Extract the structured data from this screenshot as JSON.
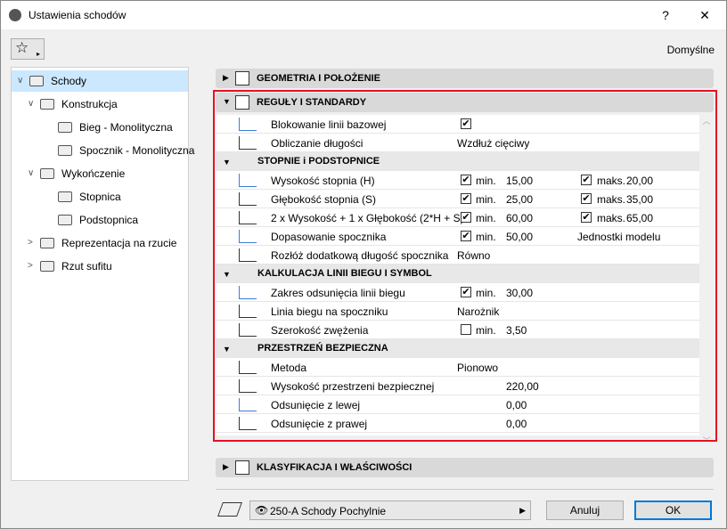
{
  "window": {
    "title": "Ustawienia schodów",
    "help": "?",
    "close": "✕"
  },
  "toolbar": {
    "favorites_icon": "☆",
    "arrow": "▸",
    "preset": "Domyślne"
  },
  "tree": [
    {
      "label": "Schody",
      "level": 0,
      "expand": "∨",
      "selected": true
    },
    {
      "label": "Konstrukcja",
      "level": 1,
      "expand": "∨"
    },
    {
      "label": "Bieg - Monolityczna",
      "level": 2
    },
    {
      "label": "Spocznik - Monolityczna",
      "level": 2
    },
    {
      "label": "Wykończenie",
      "level": 1,
      "expand": "∨"
    },
    {
      "label": "Stopnica",
      "level": 2
    },
    {
      "label": "Podstopnica",
      "level": 2
    },
    {
      "label": "Reprezentacja na rzucie",
      "level": 1,
      "expand": ">"
    },
    {
      "label": "Rzut sufitu",
      "level": 1,
      "expand": ">"
    }
  ],
  "sections": {
    "geometry": "GEOMETRIA I POŁOŻENIE",
    "rules": "REGUŁY I STANDARDY",
    "classification": "KLASYFIKACJA I WŁAŚCIWOŚCI"
  },
  "rows": [
    {
      "type": "row",
      "label": "Blokowanie linii bazowej",
      "check1": true
    },
    {
      "type": "row",
      "label": "Obliczanie długości",
      "value": "Wzdłuż cięciwy"
    },
    {
      "type": "sub",
      "label": "STOPNIE i PODSTOPNICE"
    },
    {
      "type": "row",
      "label": "Wysokość stopnia (H)",
      "check1": true,
      "min": "min.",
      "minv": "15,00",
      "check2": true,
      "max": "maks.",
      "maxv": "20,00"
    },
    {
      "type": "row",
      "label": "Głębokość stopnia (S)",
      "check1": true,
      "min": "min.",
      "minv": "25,00",
      "check2": true,
      "max": "maks.",
      "maxv": "35,00"
    },
    {
      "type": "row",
      "label": "2 x Wysokość + 1 x Głębokość (2*H + S)",
      "check1": true,
      "min": "min.",
      "minv": "60,00",
      "check2": true,
      "max": "maks.",
      "maxv": "65,00"
    },
    {
      "type": "row",
      "label": "Dopasowanie spocznika",
      "check1": true,
      "min": "min.",
      "minv": "50,00",
      "unit": "Jednostki modelu"
    },
    {
      "type": "row",
      "label": "Rozłóż dodatkową długość spocznika",
      "value": "Równo"
    },
    {
      "type": "sub",
      "label": "KALKULACJA LINII BIEGU I SYMBOL"
    },
    {
      "type": "row",
      "label": "Zakres odsunięcia linii biegu",
      "check1": true,
      "min": "min.",
      "minv": "30,00"
    },
    {
      "type": "row",
      "label": "Linia biegu na spoczniku",
      "value": "Narożnik"
    },
    {
      "type": "row",
      "label": "Szerokość zwężenia",
      "check1": false,
      "min": "min.",
      "minv": "3,50"
    },
    {
      "type": "sub",
      "label": "PRZESTRZEŃ BEZPIECZNA"
    },
    {
      "type": "row",
      "label": "Metoda",
      "value": "Pionowo"
    },
    {
      "type": "row",
      "label": "Wysokość przestrzeni bezpiecznej",
      "minv": "220,00"
    },
    {
      "type": "row",
      "label": "Odsunięcie z lewej",
      "minv": "0,00"
    },
    {
      "type": "row",
      "label": "Odsunięcie z prawej",
      "minv": "0,00"
    }
  ],
  "footer": {
    "layer": "250-A Schody Pochylnie",
    "cancel": "Anuluj",
    "ok": "OK"
  }
}
